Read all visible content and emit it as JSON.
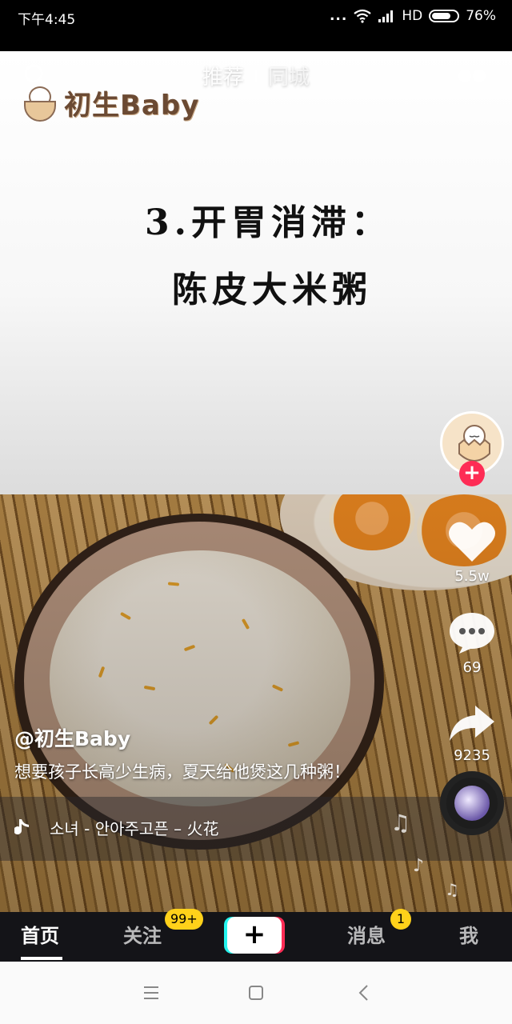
{
  "status_bar": {
    "time": "下午4:45",
    "dots": "...",
    "network": "HD",
    "battery_percent": "76%",
    "battery_level": 0.76
  },
  "top_tabs": {
    "recommend": "推荐",
    "local": "同城"
  },
  "video": {
    "logo_text": "初生Baby",
    "headline_line1": "3.开胃消滞：",
    "headline_line2": "陈皮大米粥"
  },
  "actions": {
    "likes": "5.5w",
    "comments": "69",
    "shares": "9235",
    "follow_symbol": "+"
  },
  "caption": {
    "author": "@初生Baby",
    "description": "想要孩子长高少生病，夏天给他煲这几种粥！",
    "music": "소녀 - 안아주고픈 – 火花"
  },
  "bottom_nav": {
    "home": "首页",
    "following": "关注",
    "following_badge": "99+",
    "create": "+",
    "messages": "消息",
    "messages_badge": "1",
    "me": "我"
  },
  "colors": {
    "accent_red": "#fe2c55",
    "accent_cyan": "#25f4ee",
    "badge_yellow": "#ffd11a",
    "nav_bg": "#141418"
  }
}
